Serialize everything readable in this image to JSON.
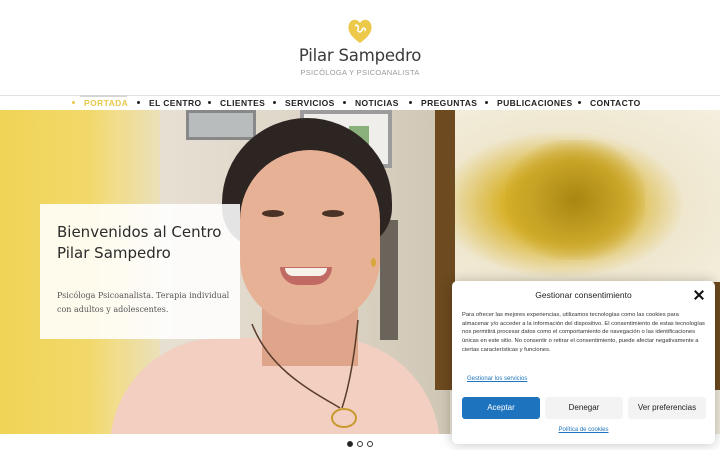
{
  "header": {
    "brand_name": "Pilar Sampedro",
    "brand_subtitle": "PSICÓLOGA Y PSICOANALISTA",
    "logo_icon": "brain-heart-icon",
    "accent_color": "#e8c84a"
  },
  "nav": {
    "items": [
      {
        "label": "PORTADA",
        "active": true
      },
      {
        "label": "EL CENTRO",
        "active": false
      },
      {
        "label": "CLIENTES",
        "active": false
      },
      {
        "label": "SERVICIOS",
        "active": false
      },
      {
        "label": "NOTICIAS",
        "active": false
      },
      {
        "label": "PREGUNTAS",
        "active": false
      },
      {
        "label": "PUBLICACIONES",
        "active": false
      },
      {
        "label": "CONTACTO",
        "active": false
      }
    ]
  },
  "hero": {
    "welcome_title": "Bienvenidos al Centro Pilar Sampedro",
    "welcome_text": "Psicóloga Psicoanalista. Terapia individual con adultos y adolescentes.",
    "slider_dots": 3,
    "active_slide": 1
  },
  "consent": {
    "title": "Gestionar consentimiento",
    "body": "Para ofrecer las mejores experiencias, utilizamos tecnologías como las cookies para almacenar y/o acceder a la información del dispositivo. El consentimiento de estas tecnologías nos permitirá procesar datos como el comportamiento de navegación o las identificaciones únicas en este sitio. No consentir o retirar el consentimiento, puede afectar negativamente a ciertas características y funciones.",
    "manage_services_link": "Gestionar los servicios",
    "accept_button": "Aceptar",
    "deny_button": "Denegar",
    "preferences_button": "Ver preferencias",
    "policy_link": "Política de cookies",
    "accept_color": "#1e73be"
  }
}
